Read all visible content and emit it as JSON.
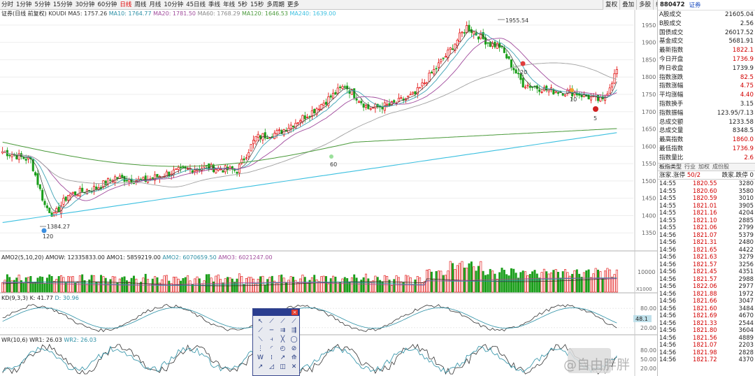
{
  "toolbar": {
    "periods": [
      "分时",
      "1分钟",
      "5分钟",
      "15分钟",
      "30分钟",
      "60分钟",
      "日线",
      "周线",
      "月线",
      "10分钟",
      "45日线",
      "季线",
      "年线",
      "5秒",
      "15秒",
      "多周期",
      "更多"
    ],
    "active_period": "日线",
    "tools": [
      "复权",
      "叠加",
      "多股",
      "统计",
      "画线",
      "F10",
      "标记",
      "-自选",
      "返回"
    ]
  },
  "main_info": {
    "prefix": "证券(日线 前复权)",
    "koudi": "KOUDI",
    "ma5": "MA5: 1757.26",
    "ma10": "MA10: 1764.77",
    "ma20": "MA20: 1781.50",
    "ma60": "MA60: 1768.29",
    "ma120": "MA120: 1646.53",
    "ma240": "MA240: 1639.00"
  },
  "amo_info": {
    "title": "AMO2(5,10,20)",
    "amow": "AMOW: 12335833.00",
    "amo1": "AMO1: 5859219.00",
    "amo2": "AMO2: 6070659.50",
    "amo3": "AMO3: 6021247.00"
  },
  "kd_info": {
    "title": "KD(9,3,3)",
    "k": "K: 41.77",
    "d": "D: 30.96"
  },
  "wr_info": {
    "title": "WR(10,6)",
    "wr1": "WR1: 26.03",
    "wr2": "WR2: 26.03"
  },
  "price_axis": [
    "1950",
    "1900",
    "1850",
    "1800",
    "1750",
    "1700",
    "1650",
    "1600",
    "1550",
    "1500",
    "1450",
    "1400",
    "1350"
  ],
  "amo_axis": {
    "top": "10000",
    "unit": "X1000"
  },
  "kd_axis": [
    "80.00",
    "48.1",
    "20.00"
  ],
  "wr_axis": [
    "80.00",
    "50.00",
    "20.00"
  ],
  "annotations": {
    "high": "1955.54",
    "low": "1384.27",
    "signal_120": "120",
    "signal_60": "60",
    "signal_20": "20",
    "signal_10": "10",
    "signal_5": "5"
  },
  "colors": {
    "up": "#e00000",
    "down": "#1a9e1a",
    "ma5": "#333333",
    "ma10": "#3fa3b5",
    "ma20": "#a04a9c",
    "ma60": "#a0a0a0",
    "ma120": "#4a9a3a",
    "ma240": "#3cc0e0"
  },
  "quote_panel": {
    "code": "880472",
    "name": "证券",
    "stats": [
      {
        "label": "A股成交",
        "value": "21605.04",
        "red": false
      },
      {
        "label": "B股成交",
        "value": "2.56",
        "red": false
      },
      {
        "label": "国债成交",
        "value": "26017.52",
        "red": false
      },
      {
        "label": "基金成交",
        "value": "5681.91",
        "red": false
      },
      {
        "label": "最新指数",
        "value": "1822.1",
        "red": true
      },
      {
        "label": "今日开盘",
        "value": "1736.9",
        "red": true
      },
      {
        "label": "昨日收盘",
        "value": "1739.9",
        "red": false
      },
      {
        "label": "指数涨跌",
        "value": "82.5",
        "red": true
      },
      {
        "label": "指数涨幅",
        "value": "4.75",
        "red": true
      },
      {
        "label": "平均涨幅",
        "value": "4.40",
        "red": true
      },
      {
        "label": "指数换手",
        "value": "3.15",
        "red": false
      },
      {
        "label": "指数振幅",
        "value": "123.95/7.13",
        "red": false
      },
      {
        "label": "总成交额",
        "value": "1233.58",
        "red": false
      },
      {
        "label": "总成交量",
        "value": "8348.5",
        "red": false
      },
      {
        "label": "最高指数",
        "value": "1860.0",
        "red": true
      },
      {
        "label": "最低指数",
        "value": "1736.9",
        "red": true
      },
      {
        "label": "指数量比",
        "value": "2.6",
        "red": true
      }
    ],
    "type_row": {
      "label": "板指类型",
      "tabs": [
        "行业",
        "加权",
        "成份股"
      ]
    },
    "count_row": {
      "label": "涨家.涨停",
      "value": "50/2",
      "label2": "跌家.跌停",
      "value2": "0"
    },
    "ticks": [
      {
        "t": "14:55",
        "p": "1820.55",
        "v": "3280"
      },
      {
        "t": "14:55",
        "p": "1820.60",
        "v": "3580"
      },
      {
        "t": "14:55",
        "p": "1820.59",
        "v": "3010"
      },
      {
        "t": "14:55",
        "p": "1821.01",
        "v": "3905"
      },
      {
        "t": "14:55",
        "p": "1821.16",
        "v": "4204"
      },
      {
        "t": "14:55",
        "p": "1821.10",
        "v": "2885"
      },
      {
        "t": "14:55",
        "p": "1821.06",
        "v": "2799"
      },
      {
        "t": "14:56",
        "p": "1821.07",
        "v": "5379"
      },
      {
        "t": "14:56",
        "p": "1821.31",
        "v": "2480"
      },
      {
        "t": "14:56",
        "p": "1821.65",
        "v": "4422"
      },
      {
        "t": "14:56",
        "p": "1821.63",
        "v": "3279"
      },
      {
        "t": "14:56",
        "p": "1821.57",
        "v": "3256"
      },
      {
        "t": "14:56",
        "p": "1821.45",
        "v": "4351"
      },
      {
        "t": "14:56",
        "p": "1821.57",
        "v": "2988"
      },
      {
        "t": "14:56",
        "p": "1822.06",
        "v": "2977"
      },
      {
        "t": "14:56",
        "p": "1821.88",
        "v": "1972"
      },
      {
        "t": "14:56",
        "p": "1821.66",
        "v": "3047"
      },
      {
        "t": "14:56",
        "p": "1821.60",
        "v": "3484"
      },
      {
        "t": "14:56",
        "p": "1821.69",
        "v": "4670"
      },
      {
        "t": "14:56",
        "p": "1821.33",
        "v": "2544"
      },
      {
        "t": "14:56",
        "p": "1821.80",
        "v": "3604"
      },
      {
        "t": "14:56",
        "p": "1821.56",
        "v": "4889"
      },
      {
        "t": "14:56",
        "p": "1821.07",
        "v": "2203"
      },
      {
        "t": "14:56",
        "p": "1821.98",
        "v": "2828"
      },
      {
        "t": "14:56",
        "p": "1821.72",
        "v": "4370"
      }
    ]
  },
  "draw_tools": [
    "cursor-icon",
    "line-icon",
    "ray-icon",
    "segment-icon",
    "arrow-icon",
    "hline-icon",
    "parallel-icon",
    "channel-icon",
    "slant-icon",
    "price-line-icon",
    "cycle-icon",
    "circle-icon",
    "fib-icon",
    "arc-icon",
    "gann-icon",
    "wave-icon",
    "wave-w-icon",
    "mark-icon",
    "up-arrow-icon",
    "bars-icon",
    "text-icon",
    "pen-icon",
    "rect-icon",
    "delete-icon"
  ],
  "draw_glyphs": [
    "↖",
    "⟋",
    "⟋",
    "⟋",
    "⟋",
    "─",
    "⇉",
    "⇶",
    "⟍",
    "⫞",
    "╳",
    "◯",
    "⋮",
    "◜",
    "◴",
    "⊘",
    "W",
    "⁞",
    "↗",
    "⟰",
    "↗",
    "◿",
    "◫",
    "✕"
  ],
  "watermark": "@自由胖胖"
}
